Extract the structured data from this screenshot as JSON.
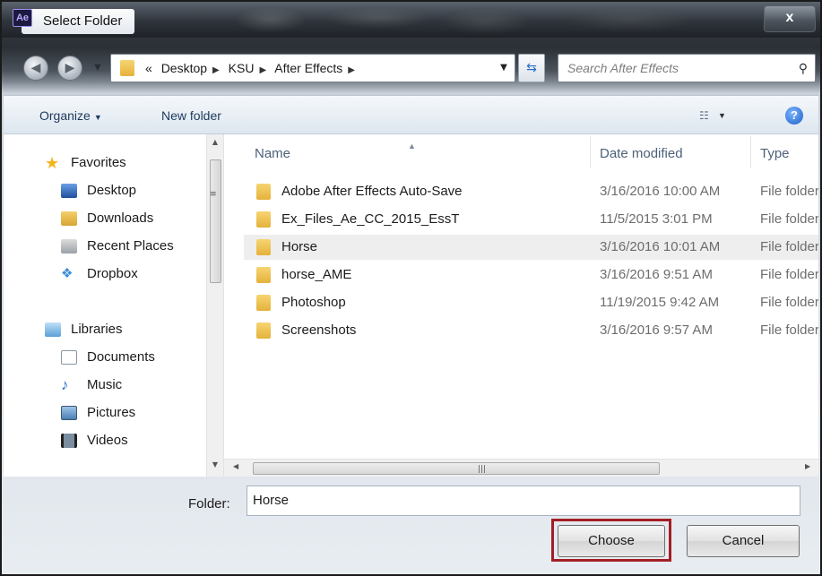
{
  "window": {
    "app_badge": "Ae",
    "title": "Select Folder",
    "close_label": "x"
  },
  "address_bar": {
    "overflow_marker": "«",
    "breadcrumbs": [
      "Desktop",
      "KSU",
      "After Effects"
    ],
    "search_placeholder": "Search After Effects"
  },
  "toolbar": {
    "organize_label": "Organize",
    "new_folder_label": "New folder",
    "help_label": "?"
  },
  "nav_pane": {
    "groups": [
      {
        "label": "Favorites",
        "items": [
          "Desktop",
          "Downloads",
          "Recent Places",
          "Dropbox"
        ]
      },
      {
        "label": "Libraries",
        "items": [
          "Documents",
          "Music",
          "Pictures",
          "Videos"
        ]
      }
    ]
  },
  "file_list": {
    "columns": [
      "Name",
      "Date modified",
      "Type"
    ],
    "rows": [
      {
        "name": "Adobe After Effects Auto-Save",
        "date": "3/16/2016 10:00 AM",
        "type": "File folder",
        "selected": false
      },
      {
        "name": "Ex_Files_Ae_CC_2015_EssT",
        "date": "11/5/2015 3:01 PM",
        "type": "File folder",
        "selected": false
      },
      {
        "name": "Horse",
        "date": "3/16/2016 10:01 AM",
        "type": "File folder",
        "selected": true
      },
      {
        "name": "horse_AME",
        "date": "3/16/2016 9:51 AM",
        "type": "File folder",
        "selected": false
      },
      {
        "name": "Photoshop",
        "date": "11/19/2015 9:42 AM",
        "type": "File folder",
        "selected": false
      },
      {
        "name": "Screenshots",
        "date": "3/16/2016 9:57 AM",
        "type": "File folder",
        "selected": false
      }
    ]
  },
  "footer": {
    "folder_label": "Folder:",
    "folder_value": "Horse",
    "choose_label": "Choose",
    "cancel_label": "Cancel",
    "highlight_color": "#a31f24"
  }
}
